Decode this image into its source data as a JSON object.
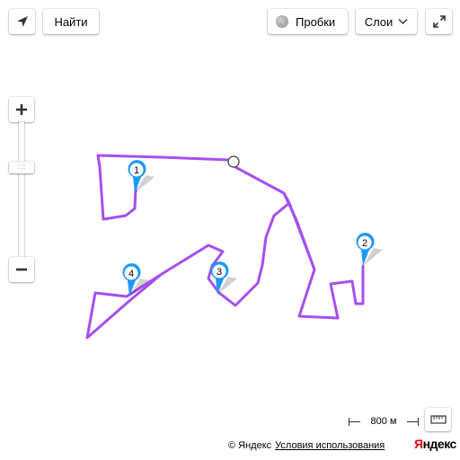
{
  "toolbar": {
    "find_label": "Найти",
    "traffic_label": "Пробки",
    "layers_label": "Слои"
  },
  "zoom": {
    "plus_label": "+",
    "minus_label": "−",
    "handle_grip": ":::::"
  },
  "route": {
    "color": "#a64ff0",
    "markers": [
      {
        "label": "1"
      },
      {
        "label": "2"
      },
      {
        "label": "3"
      },
      {
        "label": "4"
      }
    ],
    "marker_color": "#1e98ff"
  },
  "scale": {
    "label": "800 м"
  },
  "footer": {
    "copyright": "© Яндекс",
    "terms_link": "Условия использования",
    "logo_first": "Я",
    "logo_rest": "ндекс"
  }
}
